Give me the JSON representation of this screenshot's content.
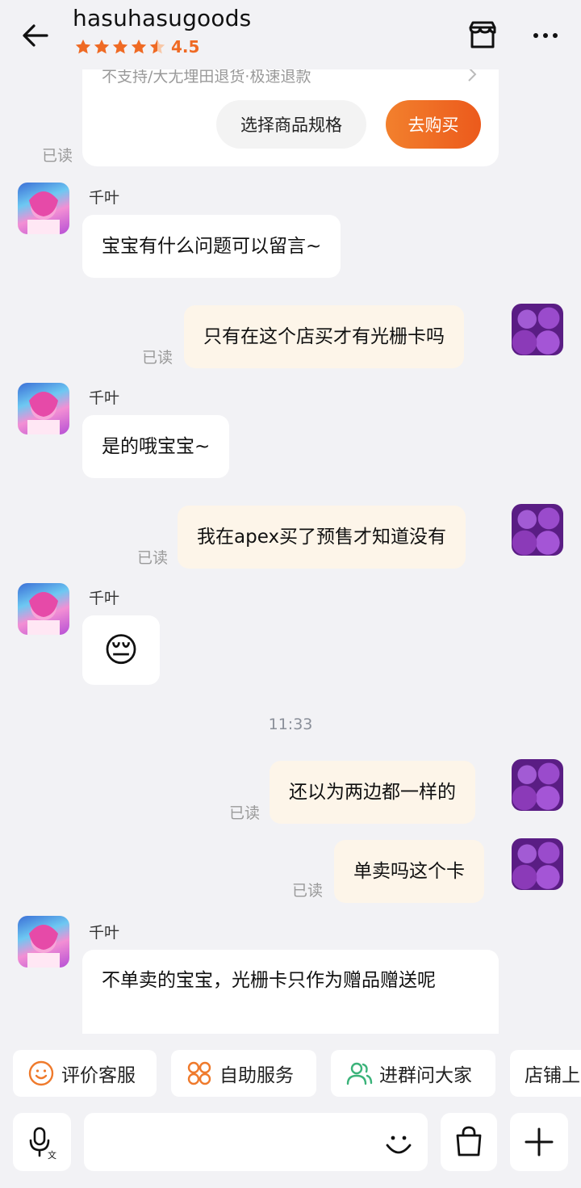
{
  "header": {
    "shop_name": "hasuhasugoods",
    "rating": "4.5",
    "icons": [
      "back-arrow-icon",
      "star-icon",
      "store-icon",
      "more-icon"
    ]
  },
  "product_card": {
    "policy_text": "不支持/大尢埋田退货·极速退款",
    "spec_button": "选择商品规格",
    "buy_button": "去购买",
    "read_label": "已读"
  },
  "messages": [
    {
      "from": "bot",
      "name": "千叶",
      "text": "宝宝有什么问题可以留言~"
    },
    {
      "from": "me",
      "text": "只有在这个店买才有光栅卡吗",
      "status": "已读"
    },
    {
      "from": "bot",
      "name": "千叶",
      "text": "是的哦宝宝~"
    },
    {
      "from": "me",
      "text": "我在apex买了预售才知道没有",
      "status": "已读"
    },
    {
      "from": "bot",
      "name": "千叶",
      "emoji": "😔"
    },
    {
      "from": "me",
      "text": "还以为两边都一样的",
      "status": "已读"
    },
    {
      "from": "me",
      "text": "单卖吗这个卡",
      "status": "已读"
    },
    {
      "from": "bot",
      "name": "千叶",
      "text": "不单卖的宝宝，光栅卡只作为赠品赠送呢"
    }
  ],
  "timestamp": "11:33",
  "quick_actions": [
    {
      "label": "评价客服",
      "icon": "smiley-icon"
    },
    {
      "label": "自助服务",
      "icon": "grid-icon"
    },
    {
      "label": "进群问大家",
      "icon": "group-icon"
    },
    {
      "label": "店铺上",
      "icon": ""
    }
  ],
  "input_bar": {
    "icons": [
      "voice-translate-icon",
      "emoji-icon",
      "shopping-bag-icon",
      "plus-icon"
    ]
  },
  "colors": {
    "accent": "#ef6a24",
    "background": "#f2f2f5",
    "outgoing_bubble": "#fdf5e9",
    "incoming_bubble": "#ffffff"
  }
}
